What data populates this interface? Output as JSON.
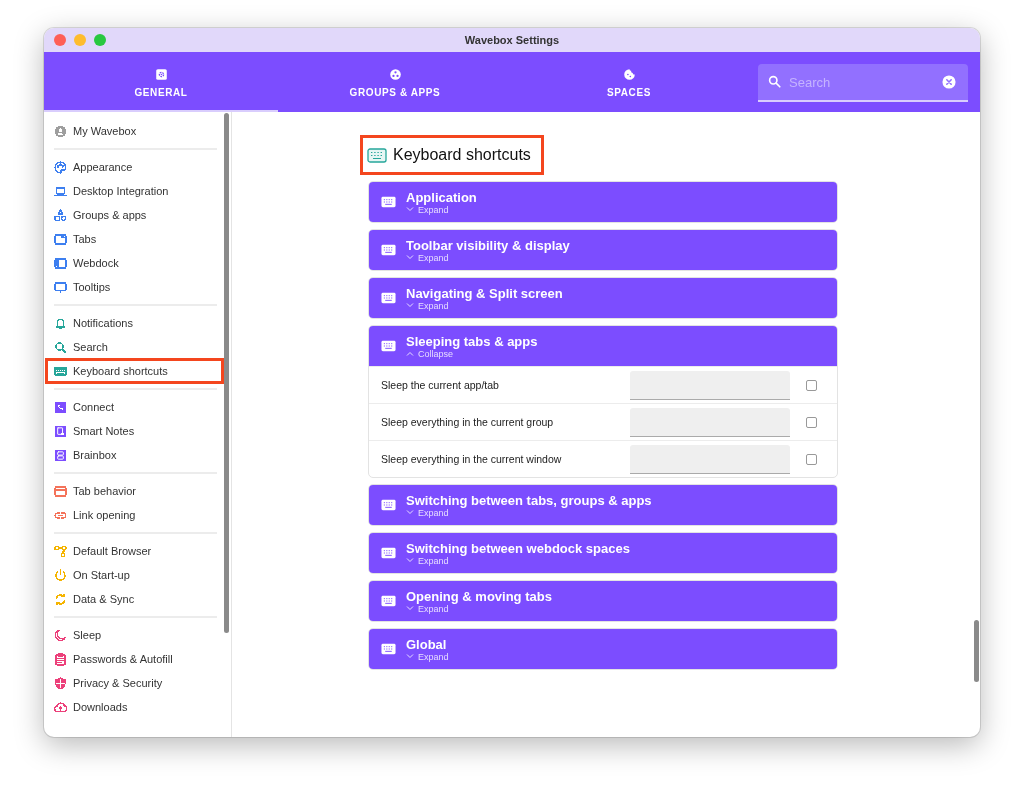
{
  "window": {
    "title": "Wavebox Settings"
  },
  "tabs": [
    {
      "label": "GENERAL",
      "selected": true
    },
    {
      "label": "GROUPS & APPS",
      "selected": false
    },
    {
      "label": "SPACES",
      "selected": false
    }
  ],
  "search": {
    "placeholder": "Search"
  },
  "sidebar": {
    "groups": [
      {
        "items": [
          {
            "label": "My Wavebox",
            "color": "#9e9e9e",
            "highlighted": false
          }
        ]
      },
      {
        "items": [
          {
            "label": "Appearance",
            "color": "#3d7ff0",
            "highlighted": false
          },
          {
            "label": "Desktop Integration",
            "color": "#3d7ff0",
            "highlighted": false
          },
          {
            "label": "Groups & apps",
            "color": "#3d7ff0",
            "highlighted": false
          },
          {
            "label": "Tabs",
            "color": "#3d7ff0",
            "highlighted": false
          },
          {
            "label": "Webdock",
            "color": "#3d7ff0",
            "highlighted": false
          },
          {
            "label": "Tooltips",
            "color": "#3d7ff0",
            "highlighted": false
          }
        ]
      },
      {
        "items": [
          {
            "label": "Notifications",
            "color": "#26a69a",
            "highlighted": false
          },
          {
            "label": "Search",
            "color": "#26a69a",
            "highlighted": false
          },
          {
            "label": "Keyboard shortcuts",
            "color": "#26a69a",
            "highlighted": true
          }
        ]
      },
      {
        "items": [
          {
            "label": "Connect",
            "color": "#7c4dff",
            "highlighted": false
          },
          {
            "label": "Smart Notes",
            "color": "#7c4dff",
            "highlighted": false
          },
          {
            "label": "Brainbox",
            "color": "#7c4dff",
            "highlighted": false
          }
        ]
      },
      {
        "items": [
          {
            "label": "Tab behavior",
            "color": "#f4735a",
            "highlighted": false
          },
          {
            "label": "Link opening",
            "color": "#f4735a",
            "highlighted": false
          }
        ]
      },
      {
        "items": [
          {
            "label": "Default Browser",
            "color": "#f5b400",
            "highlighted": false
          },
          {
            "label": "On Start-up",
            "color": "#f5b400",
            "highlighted": false
          },
          {
            "label": "Data & Sync",
            "color": "#f5b400",
            "highlighted": false
          }
        ]
      },
      {
        "items": [
          {
            "label": "Sleep",
            "color": "#ec407a",
            "highlighted": false
          },
          {
            "label": "Passwords & Autofill",
            "color": "#ec407a",
            "highlighted": false
          },
          {
            "label": "Privacy & Security",
            "color": "#ec407a",
            "highlighted": false
          },
          {
            "label": "Downloads",
            "color": "#ec407a",
            "highlighted": false
          }
        ]
      }
    ]
  },
  "page": {
    "title": "Keyboard shortcuts",
    "highlighted": true,
    "sections": [
      {
        "title": "Application",
        "expanded": false,
        "toggle": "Expand"
      },
      {
        "title": "Toolbar visibility & display",
        "expanded": false,
        "toggle": "Expand"
      },
      {
        "title": "Navigating & Split screen",
        "expanded": false,
        "toggle": "Expand"
      },
      {
        "title": "Sleeping tabs & apps",
        "expanded": true,
        "toggle": "Collapse",
        "shortcuts": [
          {
            "label": "Sleep the current app/tab",
            "checked": false
          },
          {
            "label": "Sleep everything in the current group",
            "checked": false
          },
          {
            "label": "Sleep everything in the current window",
            "checked": false
          }
        ]
      },
      {
        "title": "Switching between tabs, groups & apps",
        "expanded": false,
        "toggle": "Expand"
      },
      {
        "title": "Switching between webdock spaces",
        "expanded": false,
        "toggle": "Expand"
      },
      {
        "title": "Opening & moving tabs",
        "expanded": false,
        "toggle": "Expand"
      },
      {
        "title": "Global",
        "expanded": false,
        "toggle": "Expand"
      }
    ]
  }
}
